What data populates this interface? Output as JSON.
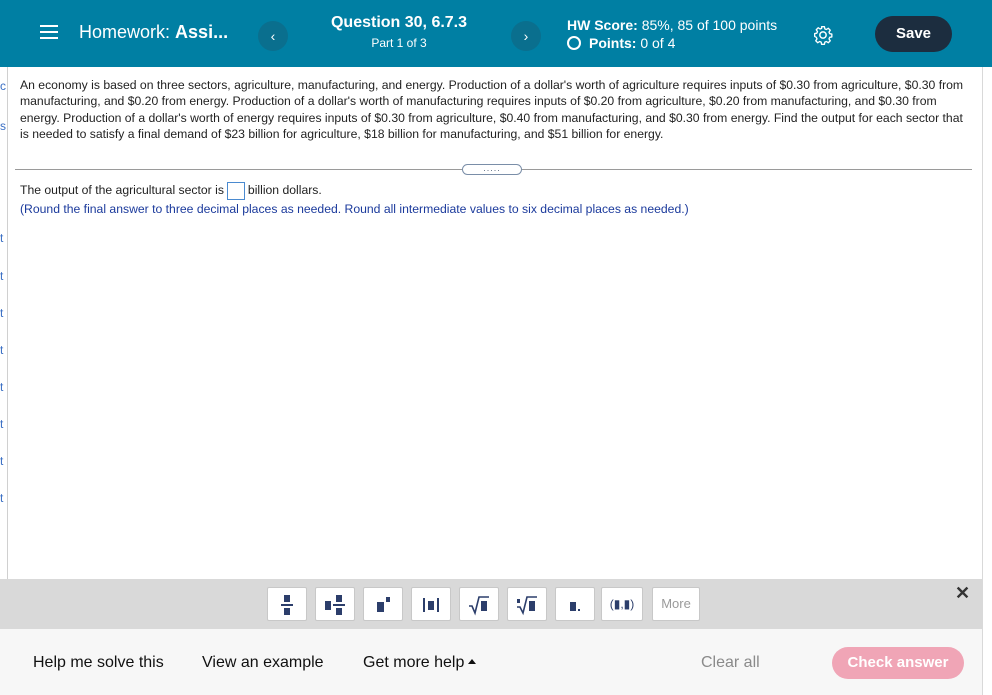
{
  "header": {
    "hw_prefix": "Homework:",
    "hw_title": "Assi...",
    "question_title": "Question 30, 6.7.3",
    "question_part": "Part 1 of 3",
    "prev_icon": "chevron-left-icon",
    "next_icon": "chevron-right-icon",
    "score_label": "HW Score:",
    "score_value": "85%, 85 of 100 points",
    "points_label": "Points:",
    "points_value": "0 of 4",
    "save_label": "Save",
    "accent": "#007fa3",
    "save_color": "#1c2d3f"
  },
  "question": {
    "text": "An economy is based on three sectors, agriculture, manufacturing, and energy. Production of a dollar's worth of agriculture requires inputs of $0.30 from agriculture, $0.30 from manufacturing, and $0.20 from energy. Production of a dollar's worth of manufacturing requires inputs of $0.20 from agriculture, $0.20 from manufacturing, and $0.30 from energy. Production of a dollar's worth of energy requires inputs of $0.30 from agriculture, $0.40 from manufacturing, and $0.30 from energy. Find the output for each sector that is needed to satisfy a final demand of $23 billion for agriculture, $18 billion for manufacturing, and $51 billion for energy.",
    "expand_label": "....."
  },
  "answer": {
    "prefix": "The output of the agricultural sector is",
    "value": "",
    "suffix": "billion dollars.",
    "instructions": "(Round the final answer to three decimal places as needed. Round all intermediate values to six decimal places as needed.)"
  },
  "toolbar": {
    "tools": [
      "fraction-icon",
      "mixed-number-icon",
      "exponent-icon",
      "absolute-value-icon",
      "square-root-icon",
      "nth-root-icon",
      "decimal-icon",
      "ordered-pair-icon"
    ],
    "ordered_pair_label": "(▮,▮)",
    "more_label": "More",
    "close_icon": "close-icon"
  },
  "bottom": {
    "help_solve": "Help me solve this",
    "view_example": "View an example",
    "get_more_help": "Get more help",
    "clear_all": "Clear all",
    "check_answer": "Check answer",
    "check_color": "#f0a5b6"
  }
}
